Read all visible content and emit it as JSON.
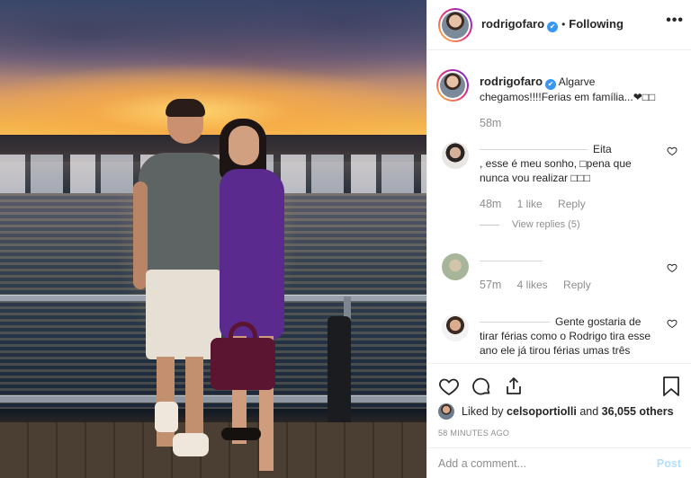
{
  "post": {
    "username": "rodrigofaro",
    "verified_mark": "✔",
    "separator": "•",
    "follow_status": "Following",
    "more_icon": "•••"
  },
  "caption": {
    "username": "rodrigofaro",
    "text": "Algarve chegamos!!!!Ferias em família...❤□□",
    "time": "58m"
  },
  "comments": [
    {
      "text_prefix": "Eita",
      "text": ", esse é meu sonho, □pena que nunca vou realizar □□□",
      "time": "48m",
      "likes": "1 like",
      "reply": "Reply",
      "view_replies": "View replies (5)"
    },
    {
      "text": "",
      "time": "57m",
      "likes": "4 likes",
      "reply": "Reply"
    },
    {
      "text": "Gente gostaria de tirar férias como o Rodrigo tira esse ano ele já tirou férias umas três vezes"
    }
  ],
  "likes": {
    "prefix": "Liked by",
    "user": "celsoportiolli",
    "and": "and",
    "count": "36,055 others"
  },
  "timestamp": "58 MINUTES AGO",
  "comment_box": {
    "placeholder": "Add a comment...",
    "post_label": "Post"
  },
  "icons": [
    "heart-icon",
    "comment-icon",
    "share-icon",
    "bookmark-icon",
    "more-icon",
    "verified-icon"
  ],
  "colors": {
    "verified": "#3897f0",
    "muted": "#8e8e8e",
    "post_disabled": "#b2dffc"
  }
}
